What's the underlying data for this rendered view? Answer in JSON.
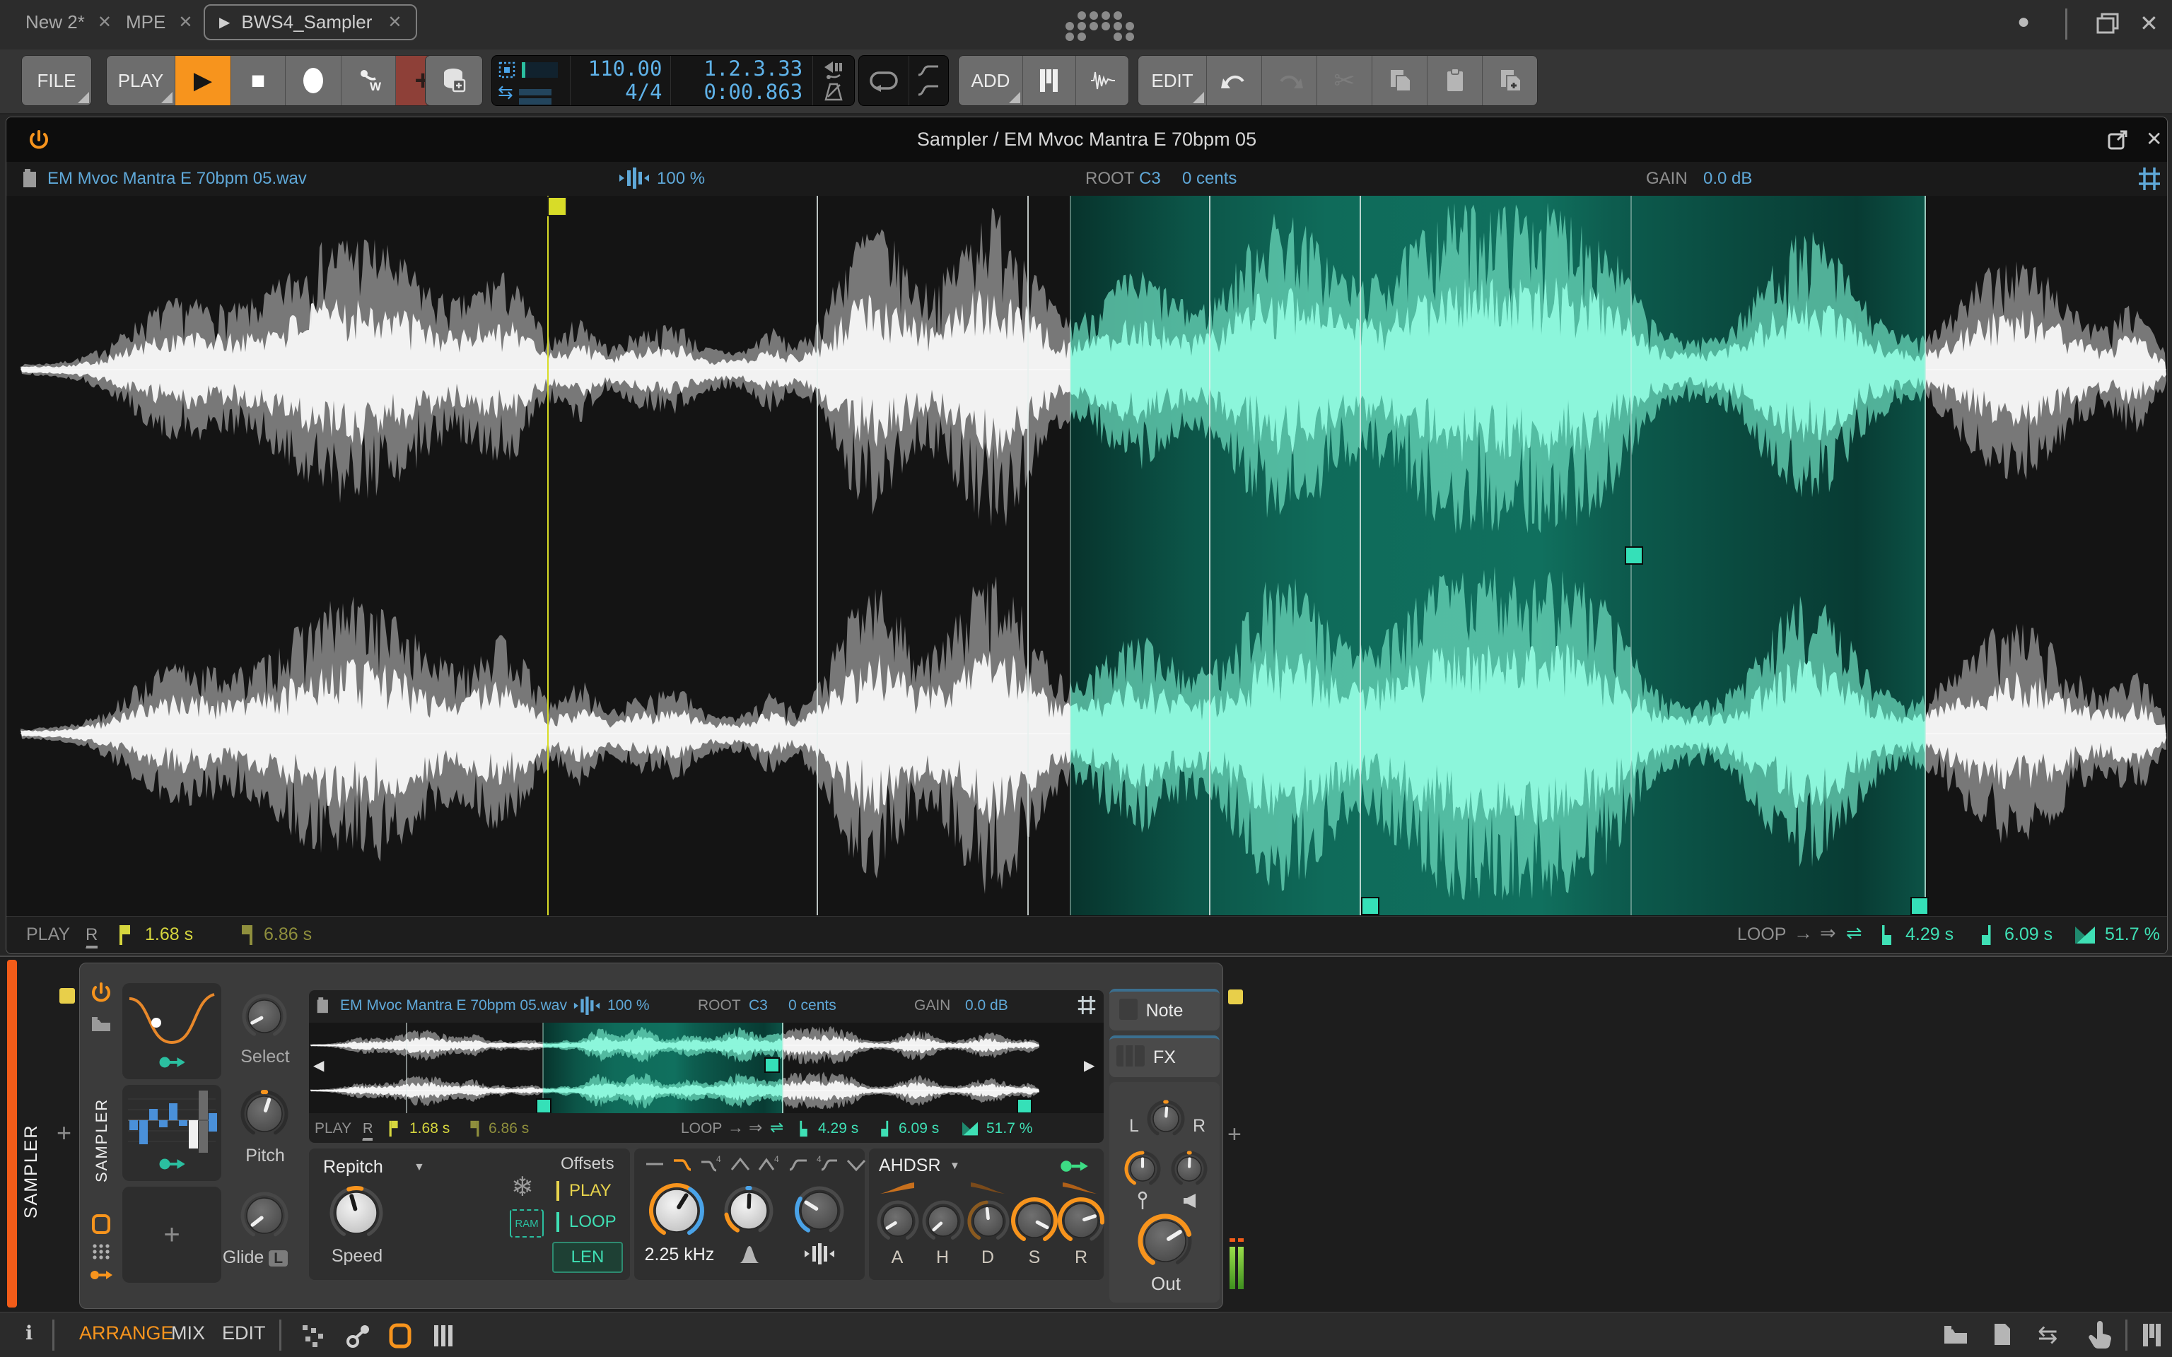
{
  "window": {
    "tabs": [
      {
        "label": "New 2*"
      },
      {
        "label": "MPE"
      },
      {
        "label": "BWS4_Sampler"
      }
    ]
  },
  "toolbar": {
    "file_label": "FILE",
    "play_label": "PLAY",
    "add_label": "ADD",
    "edit_label": "EDIT",
    "tempo": "110.00",
    "time_signature": "4/4",
    "position": "1.2.3.33",
    "time": "0:00.863"
  },
  "sampler": {
    "title": "Sampler / EM Mvoc Mantra E 70bpm 05",
    "header": {
      "file_name": "EM Mvoc Mantra E 70bpm 05.wav",
      "stretch": "100 %",
      "root_label": "ROOT",
      "root_note": "C3",
      "root_cents": "0 cents",
      "gain_label": "GAIN",
      "gain_value": "0.0 dB"
    },
    "play_bar": {
      "label": "PLAY",
      "reverse": "R",
      "start": "1.68 s",
      "end": "6.86 s"
    },
    "loop_bar": {
      "label": "LOOP",
      "start": "4.29 s",
      "end": "6.09 s",
      "crossfade": "51.7 %"
    }
  },
  "device": {
    "track_name": "SAMPLER",
    "name": "SAMPLER",
    "select_label": "Select",
    "pitch_label": "Pitch",
    "glide_label": "Glide",
    "glide_badge": "L",
    "mode": "Repitch",
    "speed_label": "Speed",
    "ram_label": "RAM",
    "offsets": {
      "title": "Offsets",
      "play": "PLAY",
      "loop": "LOOP",
      "len": "LEN"
    },
    "cutoff_value": "2.25 kHz",
    "envelope": {
      "title": "AHDSR",
      "a": "A",
      "h": "H",
      "d": "D",
      "s": "S",
      "r": "R"
    },
    "out_label": "Out",
    "tabs": {
      "note": "Note",
      "fx": "FX"
    },
    "pan": {
      "left": "L",
      "right": "R"
    }
  },
  "status_bar": {
    "arrange": "ARRANGE",
    "mix": "MIX",
    "edit": "EDIT"
  },
  "icons": {
    "close": "✕",
    "play": "▶",
    "stop": "■",
    "record": "●",
    "take_add": "+",
    "plus": "+",
    "snowflake": "❄",
    "dropdown": "▼",
    "scroll_left": "◀",
    "scroll_right": "▶",
    "info": "i",
    "scissors": "✂",
    "swap": "⇆",
    "loop_forward": "→",
    "loop_alternate": "⇒",
    "loop_pingpong": "⇌",
    "minimize": "●"
  },
  "colors": {
    "accent_orange": "#F7941D",
    "bitwig_blue": "#5FB2E8",
    "teal": "#3FE0B5",
    "yellow": "#D8DC28",
    "record_red": "#8E4038",
    "vu_green": "#7AC943"
  }
}
